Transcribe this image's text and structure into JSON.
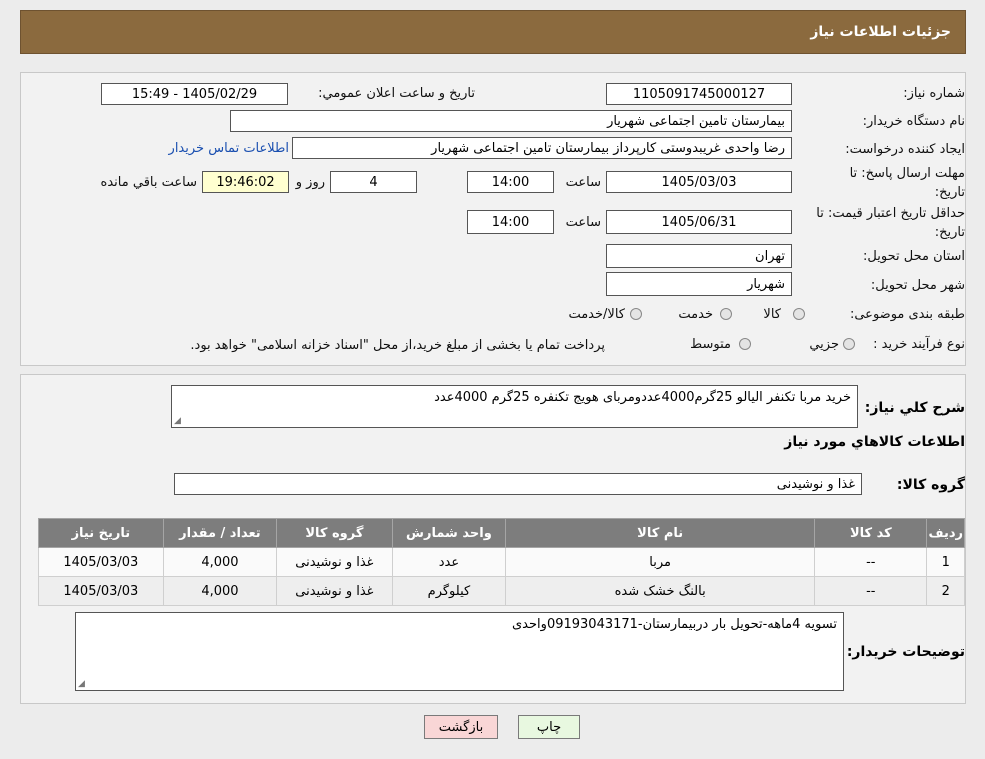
{
  "header": {
    "title": "جزئیات اطلاعات نیاز"
  },
  "form": {
    "need_number_label": "شماره نیاز:",
    "need_number": "1105091745000127",
    "announce_label": "تاريخ و ساعت اعلان عمومي:",
    "announce_value": "1405/02/29 - 15:49",
    "buyer_org_label": "نام دستگاه خريدار:",
    "buyer_org": "بیمارستان تامین اجتماعی شهریار",
    "creator_label": "ایجاد کننده درخواست:",
    "creator": "رضا واحدی غریبدوستی کارپرداز بیمارستان تامین اجتماعی شهریار",
    "contact_link": "اطلاعات تماس خريدار",
    "deadline_label_1": "مهلت ارسال پاسخ: تا",
    "deadline_label_2": "تاريخ:",
    "deadline_date": "1405/03/03",
    "time_label": "ساعت",
    "deadline_time": "14:00",
    "days_value": "4",
    "days_label": "روز و",
    "remaining_time": "19:46:02",
    "remaining_label": "ساعت باقي مانده",
    "validity_label_1": "حداقل تاريخ اعتبار قيمت: تا",
    "validity_label_2": "تاريخ:",
    "validity_date": "1405/06/31",
    "validity_time": "14:00",
    "province_label": "استان محل تحويل:",
    "province": "تهران",
    "city_label": "شهر محل تحويل:",
    "city": "شهریار",
    "category_label": "طبقه بندی موضوعی:",
    "category_options": [
      "کالا",
      "خدمت",
      "کالا/خدمت"
    ],
    "process_label": "نوع فرآيند خريد :",
    "process_options": [
      "جزيي",
      "متوسط"
    ],
    "process_note": "پرداخت تمام یا بخشی از مبلغ خرید،از محل \"اسناد خزانه اسلامی\" خواهد بود."
  },
  "details": {
    "summary_label": "شرح کلي نياز:",
    "summary": "خرید مربا تکنفر الیالو 25گرم4000عددومربای هویج تکنفره 25گرم 4000عدد",
    "goods_info_title": "اطلاعات کالاهاي مورد نياز",
    "group_label": "گروه کالا:",
    "group_value": "غذا و نوشیدنی",
    "table": {
      "headers": [
        "رديف",
        "کد کالا",
        "نام کالا",
        "واحد شمارش",
        "گروه کالا",
        "تعداد / مقدار",
        "تاريخ نياز"
      ],
      "rows": [
        [
          "1",
          "--",
          "مربا",
          "عدد",
          "غذا و نوشیدنی",
          "4,000",
          "1405/03/03"
        ],
        [
          "2",
          "--",
          "بالنگ خشک شده",
          "کیلوگرم",
          "غذا و نوشیدنی",
          "4,000",
          "1405/03/03"
        ]
      ]
    },
    "notes_label": "توضيحات خريدار:",
    "notes": "تسویه 4ماهه-تحویل بار دربیمارستان-09193043171واحدی"
  },
  "buttons": {
    "print": "چاپ",
    "back": "بازگشت"
  },
  "colors": {
    "header_bg": "#8b6a3e",
    "link": "#1a4fb0",
    "back_btn": "#f9d6d6",
    "print_btn": "#e8f8e0"
  }
}
